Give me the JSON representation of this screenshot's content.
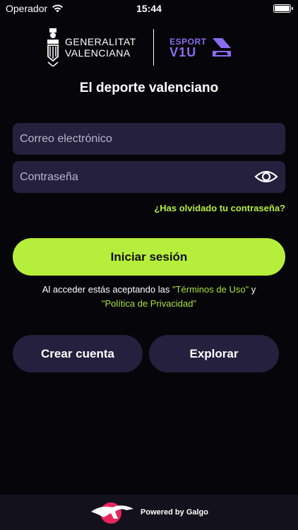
{
  "status_bar": {
    "carrier": "Operador",
    "time": "15:44",
    "battery_level": 1.0
  },
  "logos": {
    "generalitat_line1": "GENERALITAT",
    "generalitat_line2": "VALENCIANA",
    "esport_top": "ESPORT",
    "esport_bottom": "V1U"
  },
  "subtitle": "El deporte valenciano",
  "form": {
    "email_placeholder": "Correo electrónico",
    "email_value": "",
    "password_placeholder": "Contraseña",
    "password_value": "",
    "forgot_password": "¿Has olvidado tu contraseña?"
  },
  "login_button": "Iniciar sesión",
  "terms": {
    "prefix": "Al acceder estás aceptando las ",
    "terms_link": "\"Términos de Uso\"",
    "connector": " y",
    "privacy_link": "\"Política de Privacidad\""
  },
  "buttons": {
    "create_account": "Crear cuenta",
    "explore": "Explorar"
  },
  "footer": {
    "powered_by": "Powered by Galgo"
  },
  "colors": {
    "background": "#060509",
    "accent": "#b6ef3b",
    "field_bg": "#24203d",
    "brand_purple": "#8a6cf2"
  },
  "icons": [
    "wifi-icon",
    "battery-icon",
    "generalitat-shield-icon",
    "esport-logo-icon",
    "eye-icon",
    "galgo-logo-icon"
  ]
}
